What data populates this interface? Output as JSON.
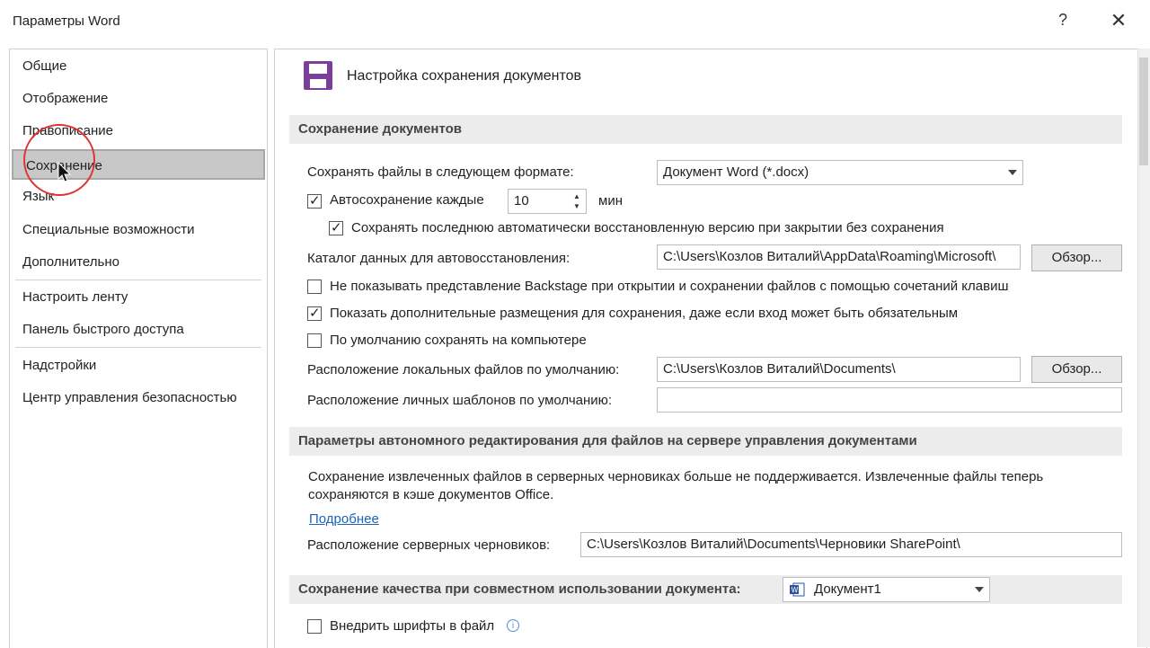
{
  "window": {
    "title": "Параметры Word",
    "help": "?",
    "close": "✕"
  },
  "sidebar": {
    "items": [
      {
        "label": "Общие"
      },
      {
        "label": "Отображение"
      },
      {
        "label": "Правописание"
      },
      {
        "label": "Сохранение",
        "selected": true
      },
      {
        "label": "Язык"
      },
      {
        "label": "Специальные возможности"
      },
      {
        "label": "Дополнительно"
      },
      {
        "label": "Настроить ленту"
      },
      {
        "label": "Панель быстрого доступа"
      },
      {
        "label": "Надстройки"
      },
      {
        "label": "Центр управления безопасностью"
      }
    ]
  },
  "header": {
    "title": "Настройка сохранения документов",
    "icon": "floppy-disk-icon"
  },
  "save_docs": {
    "section_title": "Сохранение документов",
    "format_label": "Сохранять файлы в следующем формате:",
    "format_value": "Документ Word (*.docx)",
    "autosave_label": "Автосохранение каждые",
    "autosave_checked": true,
    "autosave_minutes": "10",
    "autosave_unit": "мин",
    "keep_last_label": "Сохранять последнюю автоматически восстановленную версию при закрытии без сохранения",
    "keep_last_checked": true,
    "autorecover_label": "Каталог данных для автовосстановления:",
    "autorecover_path": "C:\\Users\\Козлов Виталий\\AppData\\Roaming\\Microsoft\\",
    "browse_label": "Обзор...",
    "no_backstage_label": "Не показывать представление Backstage при открытии и сохранении файлов с помощью сочетаний клавиш",
    "no_backstage_checked": false,
    "show_extra_label": "Показать дополнительные размещения для сохранения, даже если вход может быть обязательным",
    "show_extra_checked": true,
    "save_local_label": "По умолчанию сохранять на компьютере",
    "save_local_checked": false,
    "local_loc_label": "Расположение локальных файлов по умолчанию:",
    "local_loc_path": "C:\\Users\\Козлов Виталий\\Documents\\",
    "templates_label": "Расположение личных шаблонов по умолчанию:",
    "templates_path": ""
  },
  "offline": {
    "section_title": "Параметры автономного редактирования для файлов на сервере управления документами",
    "description": "Сохранение извлеченных файлов в серверных черновиках больше не поддерживается. Извлеченные файлы теперь сохраняются в кэше документов Office.",
    "more_link": "Подробнее",
    "drafts_label": "Расположение серверных черновиков:",
    "drafts_path": "C:\\Users\\Козлов Виталий\\Documents\\Черновики SharePoint\\"
  },
  "fidelity": {
    "section_title": "Сохранение качества при совместном использовании документа:",
    "document_value": "Документ1",
    "embed_fonts_label": "Внедрить шрифты в файл",
    "embed_fonts_checked": false
  },
  "colors": {
    "accent": "#7a3f98",
    "link": "#1b64b8",
    "section_bg": "#ececec",
    "highlight_ring": "#d33333"
  }
}
